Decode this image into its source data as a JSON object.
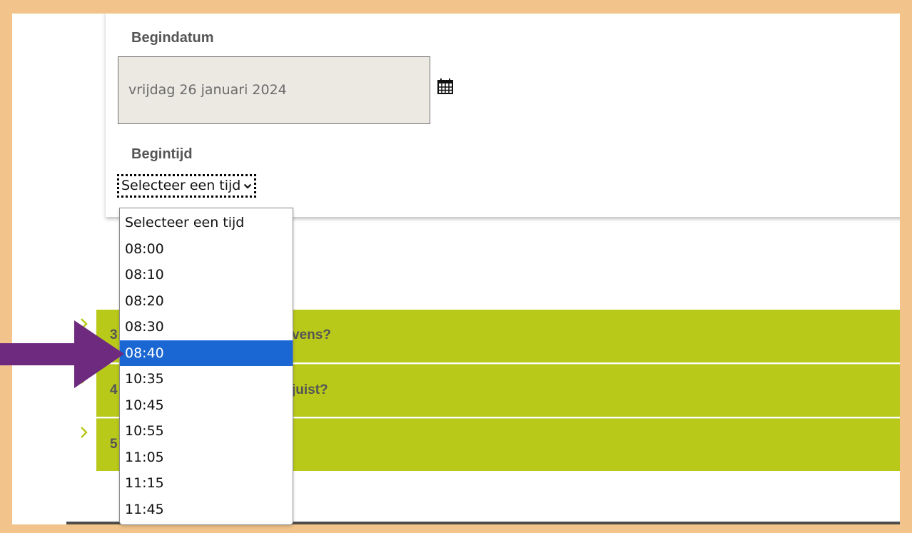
{
  "form": {
    "start_date_label": "Begindatum",
    "start_date_value": "vrijdag 26 januari 2024",
    "calendar_icon": "calendar-icon",
    "start_time_label": "Begintijd",
    "start_time_selected": "Selecteer een tijd"
  },
  "dropdown": {
    "options": [
      "Selecteer een tijd",
      "08:00",
      "08:10",
      "08:20",
      "08:30",
      "08:40",
      "10:35",
      "10:45",
      "10:55",
      "11:05",
      "11:15",
      "11:45"
    ],
    "highlighted": "08:40"
  },
  "accordion": {
    "items": [
      {
        "number": "3",
        "text_visible": "vens?"
      },
      {
        "number": "4",
        "text_visible": "juist?"
      },
      {
        "number": "5",
        "text_visible": ""
      }
    ]
  },
  "colors": {
    "frame": "#f2c48b",
    "accordion": "#b8c91a",
    "highlight": "#1a66d2",
    "arrow": "#6e2a7e"
  }
}
